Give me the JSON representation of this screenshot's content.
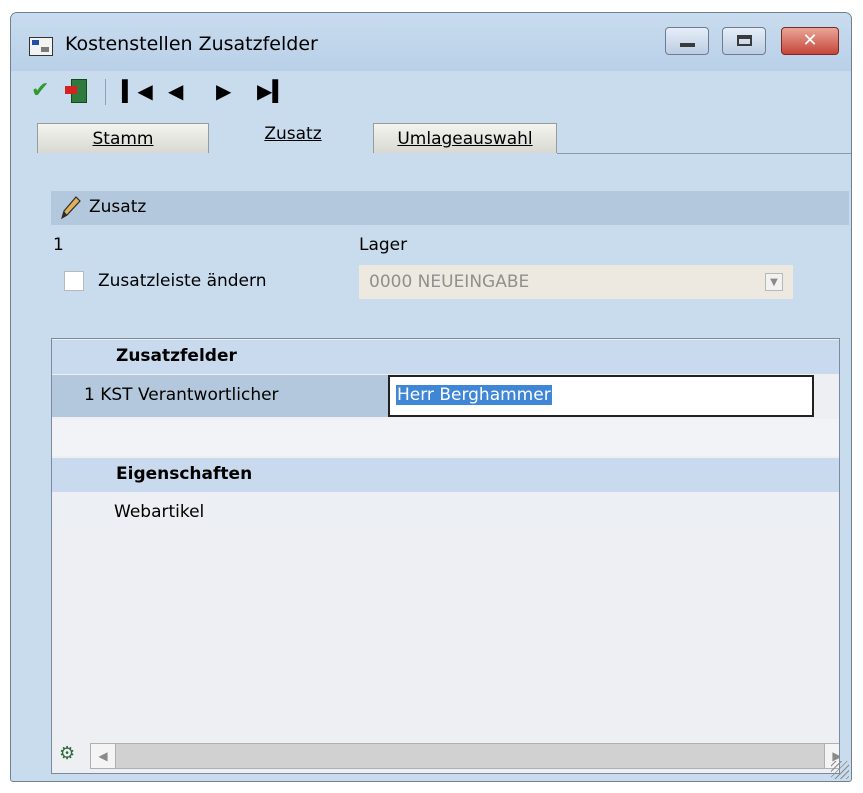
{
  "window": {
    "title": "Kostenstellen Zusatzfelder",
    "controls": {
      "minimize": "",
      "maximize": "",
      "close": "✕"
    }
  },
  "toolbar": {
    "ok_icon": "checkmark-icon",
    "exit_icon": "exit-door-icon",
    "first_glyph": "◀◀",
    "prev_glyph": "◀",
    "next_glyph": "▶",
    "last_glyph": "▶▶"
  },
  "tabs": [
    {
      "label": "Stamm",
      "active": false
    },
    {
      "label": "Zusatz",
      "active": true
    },
    {
      "label": "Umlageauswahl",
      "active": false
    }
  ],
  "zusatz": {
    "section_title": "Zusatz",
    "number": "1",
    "lager_label": "Lager",
    "checkbox_label": "Zusatzleiste ändern",
    "checkbox_checked": false,
    "lager_value": "0000 NEUEINGABE"
  },
  "grid": {
    "zusatzfelder_header": "Zusatzfelder",
    "kst_label": "1 KST Verantwortlicher",
    "kst_value": "Herr Berghammer",
    "eigenschaften_header": "Eigenschaften",
    "webartikel_label": "Webartikel"
  },
  "colors": {
    "window_bg": "#c9dcee",
    "section_bar": "#b4c8dd",
    "selection": "#3f86d6",
    "close_button": "#c7453a"
  }
}
